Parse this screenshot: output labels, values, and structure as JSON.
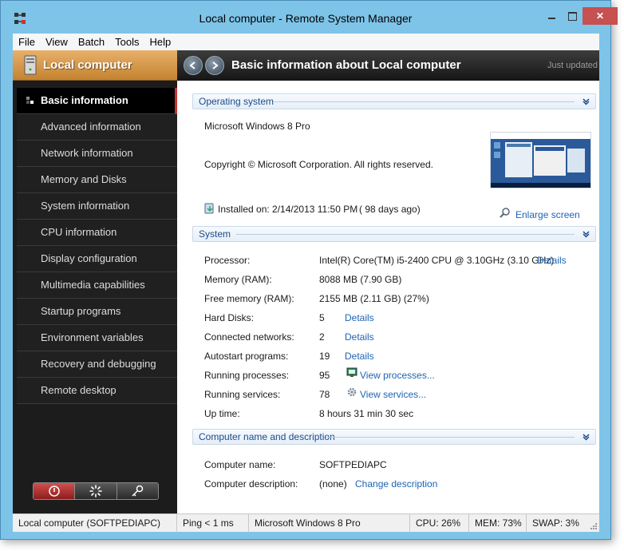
{
  "window": {
    "title": "Local computer - Remote System Manager"
  },
  "menu": [
    "File",
    "View",
    "Batch",
    "Tools",
    "Help"
  ],
  "sidebar": {
    "header": "Local computer",
    "items": [
      "Basic information",
      "Advanced information",
      "Network information",
      "Memory and Disks",
      "System information",
      "CPU information",
      "Display configuration",
      "Multimedia capabilities",
      "Startup programs",
      "Environment variables",
      "Recovery and debugging",
      "Remote desktop"
    ],
    "active_index": 0
  },
  "header": {
    "title": "Basic information about Local computer",
    "status": "Just updated"
  },
  "os": {
    "section_title": "Operating system",
    "name": "Microsoft Windows 8 Pro",
    "copyright": "Copyright © Microsoft Corporation. All rights reserved.",
    "installed": "Installed on: 2/14/2013 11:50 PM",
    "days_ago": "( 98 days ago)",
    "enlarge_label": "Enlarge screen"
  },
  "system": {
    "section_title": "System",
    "processor_label": "Processor:",
    "processor_value": "Intel(R) Core(TM) i5-2400 CPU @ 3.10GHz (3.10 GHz)",
    "processor_link": "Details",
    "memory_label": "Memory (RAM):",
    "memory_value": "8088 MB (7.90 GB)",
    "free_label": "Free memory (RAM):",
    "free_value": "2155 MB (2.11 GB) (27%)",
    "disks_label": "Hard Disks:",
    "disks_value": "5",
    "disks_link": "Details",
    "networks_label": "Connected networks:",
    "networks_value": "2",
    "networks_link": "Details",
    "autostart_label": "Autostart programs:",
    "autostart_value": "19",
    "autostart_link": "Details",
    "processes_label": "Running processes:",
    "processes_value": "95",
    "processes_link": "View processes...",
    "services_label": "Running services:",
    "services_value": "78",
    "services_link": "View services...",
    "uptime_label": "Up time:",
    "uptime_value": "8 hours 31 min 30 sec"
  },
  "computer": {
    "section_title": "Computer name and description",
    "name_label": "Computer name:",
    "name_value": "SOFTPEDIAPC",
    "desc_label": "Computer description:",
    "desc_value": "(none)",
    "desc_link": "Change description"
  },
  "statusbar": {
    "computer": "Local computer (SOFTPEDIAPC)",
    "ping": "Ping < 1 ms",
    "os": "Microsoft Windows 8 Pro",
    "cpu": "CPU: 26%",
    "mem": "MEM: 73%",
    "swap": "SWAP: 3%"
  },
  "colors": {
    "accent": "#c48330",
    "link": "#1e64b4",
    "titlebar": "#7ec4e8",
    "close": "#c75050"
  }
}
